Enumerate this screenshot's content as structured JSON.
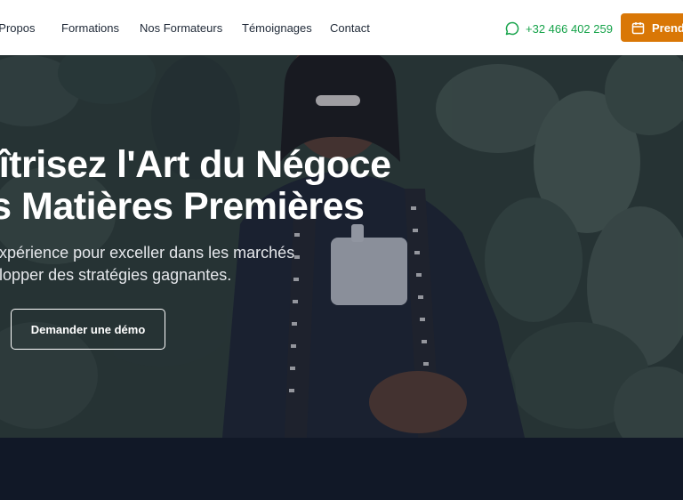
{
  "nav": {
    "links": [
      {
        "label": "À Propos"
      },
      {
        "label": "Formations"
      },
      {
        "label": "Nos Formateurs"
      },
      {
        "label": "Témoignages"
      },
      {
        "label": "Contact"
      }
    ],
    "phone": "+32 466 402 259",
    "phone_icon": "whatsapp-icon",
    "cta_label": "Prendre rendez-vous",
    "cta_icon": "calendar-icon"
  },
  "hero": {
    "title_line1": "Maîtrisez l'Art du Négoce",
    "title_line2": "des Matières Premières",
    "subtitle_line1": "Notre expérience pour exceller dans les marchés",
    "subtitle_line2": "et développer des stratégies gagnantes.",
    "demo_button": "Demander une démo"
  },
  "colors": {
    "accent_green": "#16a34a",
    "cta_orange": "#d97706",
    "dark_section": "#111827"
  }
}
